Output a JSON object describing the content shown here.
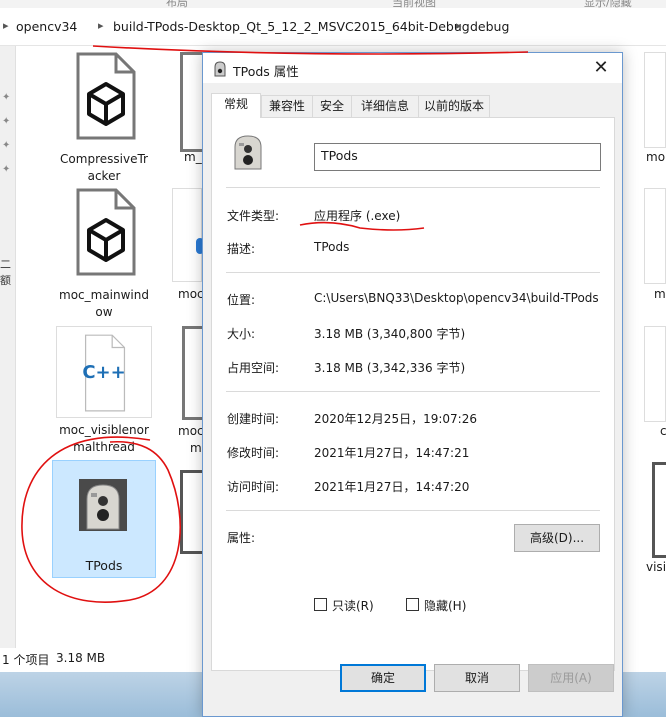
{
  "top_strip": {
    "left_text": "布局",
    "right_text": "当前视图",
    "far_right_text": "显示/隐藏"
  },
  "breadcrumb": {
    "items": [
      "opencv34",
      "build-TPods-Desktop_Qt_5_12_2_MSVC2015_64bit-Debug",
      "debug"
    ]
  },
  "left_pane": {
    "clipped_text": "二额"
  },
  "files": {
    "compressive": {
      "label_line1": "CompressiveTr",
      "label_line2": "acker"
    },
    "moc_mainwindow": {
      "label_line1": "moc_mainwind",
      "label_line2": "ow"
    },
    "moc_visible": {
      "label_line1": "moc_visiblenor",
      "label_line2": "malthread",
      "badge": "C++"
    },
    "tpods": {
      "label": "TPods"
    },
    "col2": {
      "r1": "m_t",
      "r2": "moc",
      "r3": "moc",
      "r3b": "m"
    },
    "right_col": {
      "r1": "mo",
      "r2": "m",
      "r3": "c",
      "r4": "visi"
    }
  },
  "status_bar": {
    "count": "1 个项目",
    "size": "3.18 MB"
  },
  "dialog": {
    "title": "TPods 属性",
    "close_glyph": "✕",
    "tabs": [
      "常规",
      "兼容性",
      "安全",
      "详细信息",
      "以前的版本"
    ],
    "file_name": "TPods",
    "rows": {
      "type_label": "文件类型:",
      "type_value": "应用程序 (.exe)",
      "desc_label": "描述:",
      "desc_value": "TPods",
      "location_label": "位置:",
      "location_value": "C:\\Users\\BNQ33\\Desktop\\opencv34\\build-TPods",
      "size_label": "大小:",
      "size_value": "3.18 MB (3,340,800 字节)",
      "disk_label": "占用空间:",
      "disk_value": "3.18 MB (3,342,336 字节)",
      "created_label": "创建时间:",
      "created_value": "2020年12月25日，19:07:26",
      "modified_label": "修改时间:",
      "modified_value": "2021年1月27日，14:47:21",
      "accessed_label": "访问时间:",
      "accessed_value": "2021年1月27日，14:47:20",
      "attr_label": "属性:"
    },
    "attributes": {
      "readonly": "只读(R)",
      "hidden": "隐藏(H)",
      "advanced": "高级(D)..."
    },
    "buttons": {
      "ok": "确定",
      "cancel": "取消",
      "apply": "应用(A)"
    }
  },
  "colors": {
    "selection": "#cce8ff",
    "accent": "#0078d7",
    "annotation": "#e01010"
  }
}
